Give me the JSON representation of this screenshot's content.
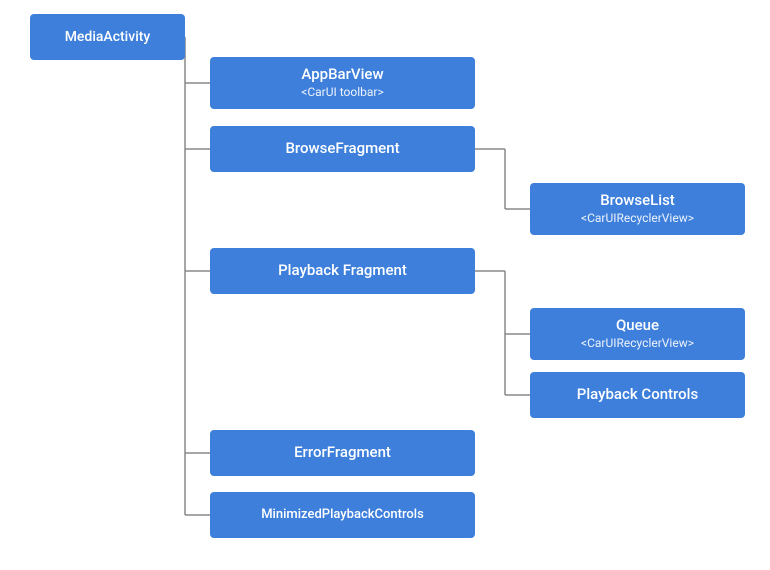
{
  "nodes": {
    "media_activity": {
      "label": "MediaActivity",
      "subtitle": ""
    },
    "appbar_view": {
      "label": "AppBarView",
      "subtitle": "<CarUI toolbar>"
    },
    "browse_fragment": {
      "label": "BrowseFragment",
      "subtitle": ""
    },
    "browse_list": {
      "label": "BrowseList",
      "subtitle": "<CarUIRecyclerView>"
    },
    "playback_fragment": {
      "label": "Playback Fragment",
      "subtitle": ""
    },
    "queue": {
      "label": "Queue",
      "subtitle": "<CarUIRecyclerView>"
    },
    "playback_controls": {
      "label": "Playback Controls",
      "subtitle": ""
    },
    "error_fragment": {
      "label": "ErrorFragment",
      "subtitle": ""
    },
    "minimized_playback_controls": {
      "label": "MinimizedPlaybackControls",
      "subtitle": ""
    }
  },
  "colors": {
    "node_bg": "#3d7fdb",
    "connector": "#888888",
    "bg": "#ffffff"
  }
}
